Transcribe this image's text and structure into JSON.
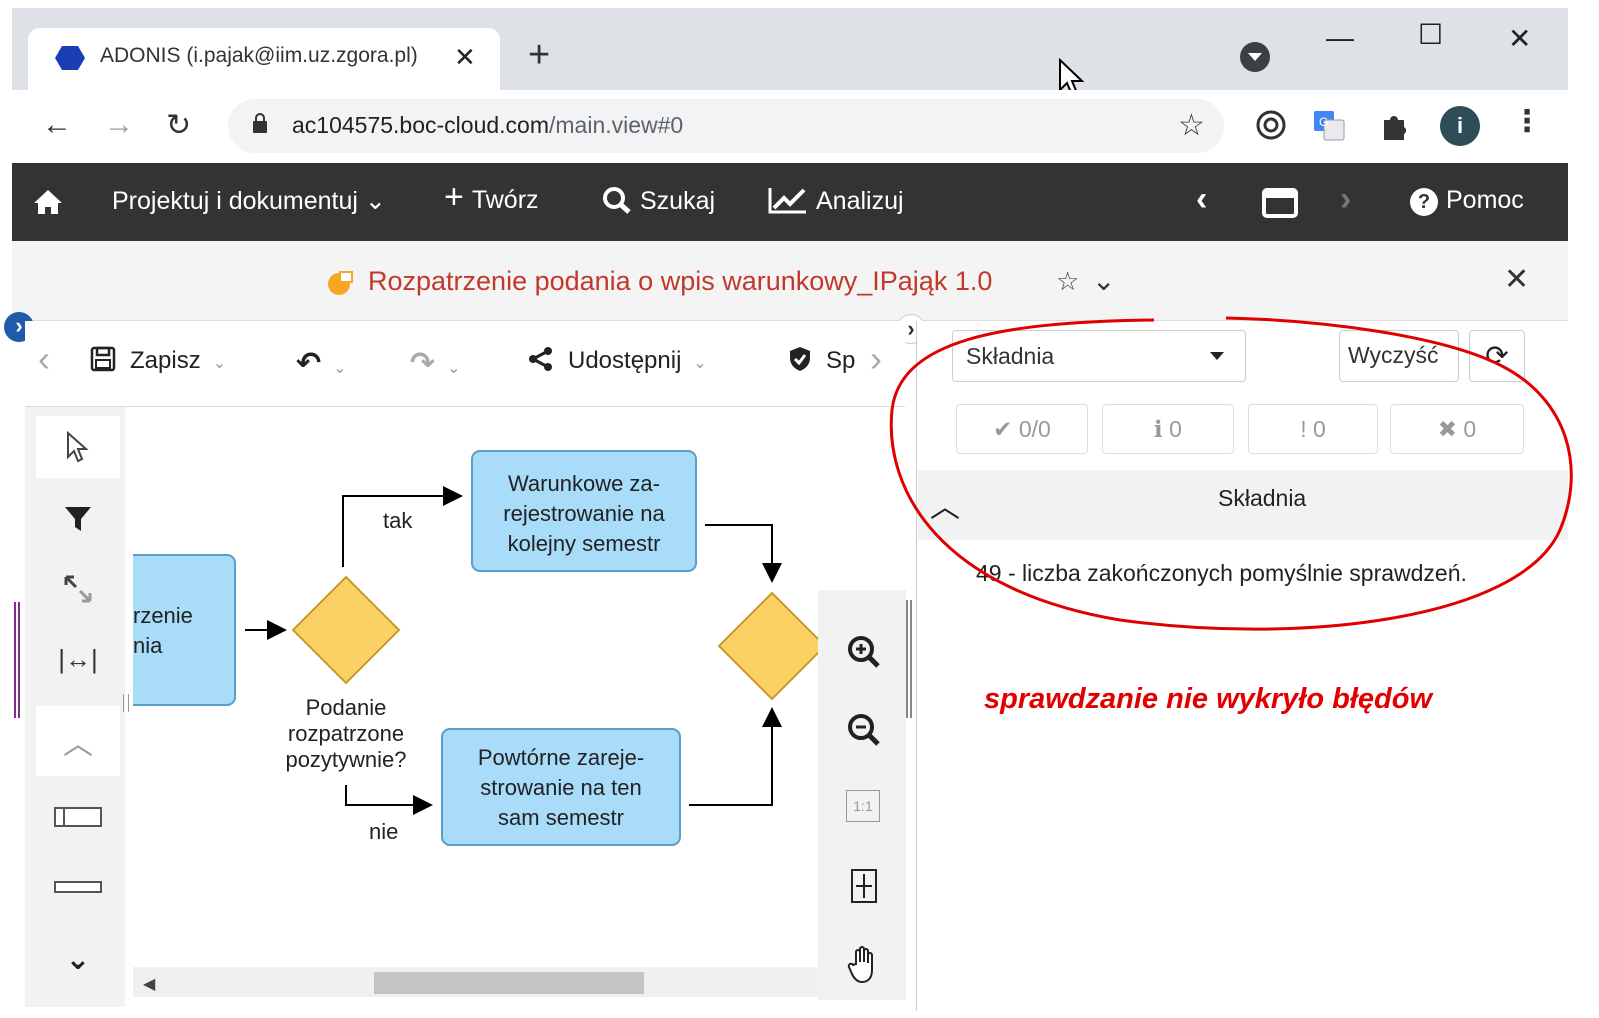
{
  "browser": {
    "tab_title": "ADONIS (i.pajak@iim.uz.zgora.pl)",
    "tab_close": "✕",
    "new_tab": "+",
    "url_host": "ac104575.boc-cloud.com",
    "url_path": "/main.view#0",
    "avatar_letter": "i"
  },
  "appnav": {
    "design": "Projektuj i dokumentuj",
    "create": "Twórz",
    "search": "Szukaj",
    "analyze": "Analizuj",
    "help": "Pomoc"
  },
  "document": {
    "title": "Rozpatrzenie podania o wpis warunkowy_IPająk 1.0"
  },
  "editor_toolbar": {
    "save": "Zapisz",
    "share": "Udostępnij",
    "check_truncated": "Sp"
  },
  "diagram": {
    "task_left_line1": "rzenie",
    "task_left_line2": "nia",
    "task_top": [
      "Warunkowe za-",
      "rejestrowanie na",
      "kolejny semestr"
    ],
    "task_bottom": [
      "Powtórne zareje-",
      "strowanie na ten",
      "sam semestr"
    ],
    "gateway_label": [
      "Podanie",
      "rozpatrzone",
      "pozytywnie?"
    ],
    "edge_yes": "tak",
    "edge_no": "nie"
  },
  "zoom": {
    "fit_label": "1:1"
  },
  "panel": {
    "select_value": "Składnia",
    "clear_button": "Wyczyść",
    "counters": [
      "✔ 0/0",
      "ℹ 0",
      "! 0",
      "✖ 0"
    ],
    "section_title": "Składnia",
    "message": "49 - liczba zakończonych pomyślnie sprawdzeń.",
    "annotation": "sprawdzanie nie wykryło błędów"
  },
  "colors": {
    "task_fill": "#a8dcf9",
    "task_stroke": "#5b9ec9",
    "gateway_fill": "#fcd163",
    "gateway_stroke": "#c69a2c",
    "nav_bg": "#333333",
    "doc_title": "#c0392b",
    "annotation": "#e00000",
    "highlight_ellipse": "#e00000"
  }
}
